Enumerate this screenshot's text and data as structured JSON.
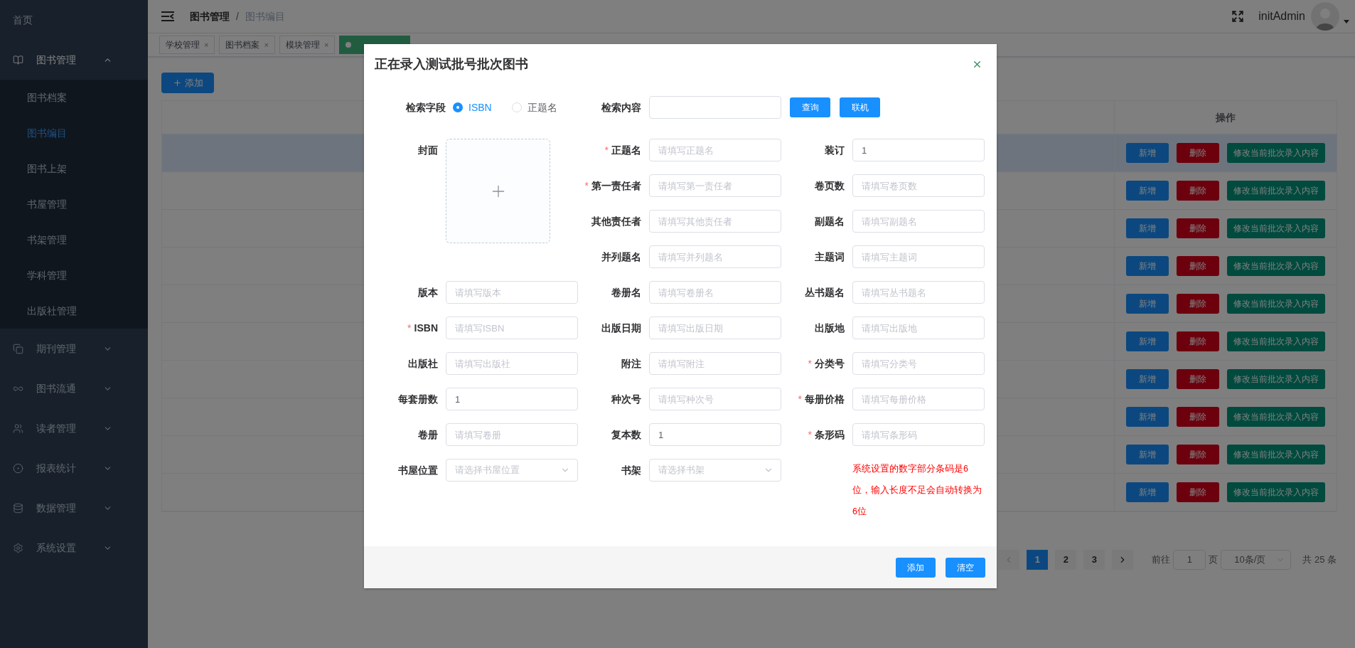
{
  "sidebar": {
    "items": [
      {
        "label": "首页",
        "expanded": false
      },
      {
        "label": "图书管理",
        "expanded": true,
        "children": [
          {
            "label": "图书档案",
            "selected": false
          },
          {
            "label": "图书编目",
            "selected": true
          },
          {
            "label": "图书上架",
            "selected": false
          },
          {
            "label": "书屋管理",
            "selected": false
          },
          {
            "label": "书架管理",
            "selected": false
          },
          {
            "label": "学科管理",
            "selected": false
          },
          {
            "label": "出版社管理",
            "selected": false
          }
        ]
      },
      {
        "label": "期刊管理",
        "expanded": false
      },
      {
        "label": "图书流通",
        "expanded": false
      },
      {
        "label": "读者管理",
        "expanded": false
      },
      {
        "label": "报表统计",
        "expanded": false
      },
      {
        "label": "数据管理",
        "expanded": false
      },
      {
        "label": "系统设置",
        "expanded": false
      }
    ]
  },
  "header": {
    "breadcrumb": [
      "图书管理",
      "图书编目"
    ],
    "separator": "/",
    "user": "initAdmin"
  },
  "tags": [
    {
      "label": "学校管理",
      "selected": false
    },
    {
      "label": "图书档案",
      "selected": false
    },
    {
      "label": "模块管理",
      "selected": false
    },
    {
      "selected": true
    }
  ],
  "tag_close": "×",
  "add_button": "添加",
  "table": {
    "columns": [
      "操作"
    ],
    "rows": [
      {
        "selected": true,
        "actions": [
          {
            "kind": "add",
            "label": "新增"
          },
          {
            "kind": "delete",
            "label": "删除"
          },
          {
            "kind": "edit",
            "label": "修改当前批次录入内容"
          }
        ]
      },
      {
        "selected": false,
        "actions": [
          {
            "kind": "add",
            "label": "新增"
          },
          {
            "kind": "delete",
            "label": "删除"
          },
          {
            "kind": "edit",
            "label": "修改当前批次录入内容"
          }
        ]
      },
      {
        "selected": false,
        "actions": [
          {
            "kind": "add",
            "label": "新增"
          },
          {
            "kind": "delete",
            "label": "删除"
          },
          {
            "kind": "edit",
            "label": "修改当前批次录入内容"
          }
        ]
      },
      {
        "selected": false,
        "actions": [
          {
            "kind": "add",
            "label": "新增"
          },
          {
            "kind": "delete",
            "label": "删除"
          },
          {
            "kind": "edit",
            "label": "修改当前批次录入内容"
          }
        ]
      },
      {
        "selected": false,
        "actions": [
          {
            "kind": "add",
            "label": "新增"
          },
          {
            "kind": "delete",
            "label": "删除"
          },
          {
            "kind": "edit",
            "label": "修改当前批次录入内容"
          }
        ]
      },
      {
        "selected": false,
        "actions": [
          {
            "kind": "add",
            "label": "新增"
          },
          {
            "kind": "delete",
            "label": "删除"
          },
          {
            "kind": "edit",
            "label": "修改当前批次录入内容"
          }
        ]
      },
      {
        "selected": false,
        "actions": [
          {
            "kind": "add",
            "label": "新增"
          },
          {
            "kind": "delete",
            "label": "删除"
          },
          {
            "kind": "edit",
            "label": "修改当前批次录入内容"
          }
        ]
      },
      {
        "selected": false,
        "actions": [
          {
            "kind": "add",
            "label": "新增"
          },
          {
            "kind": "delete",
            "label": "删除"
          },
          {
            "kind": "edit",
            "label": "修改当前批次录入内容"
          }
        ]
      },
      {
        "selected": false,
        "actions": [
          {
            "kind": "add",
            "label": "新增"
          },
          {
            "kind": "delete",
            "label": "删除"
          },
          {
            "kind": "edit",
            "label": "修改当前批次录入内容"
          }
        ]
      },
      {
        "selected": false,
        "actions": [
          {
            "kind": "add",
            "label": "新增"
          },
          {
            "kind": "delete",
            "label": "删除"
          },
          {
            "kind": "edit",
            "label": "修改当前批次录入内容"
          }
        ]
      }
    ]
  },
  "pagination": {
    "prev_disabled": true,
    "pages": [
      {
        "label": "1",
        "selected": true
      },
      {
        "label": "2",
        "selected": false
      },
      {
        "label": "3",
        "selected": false
      }
    ],
    "goto_label": "前往",
    "goto_value": "1",
    "goto_unit": "页",
    "page_size": "10条/页",
    "total": "共 25 条"
  },
  "dialog": {
    "title": "正在录入测试批号批次图书",
    "search": {
      "field_label": "检索字段",
      "options": [
        {
          "label": "ISBN",
          "selected": true
        },
        {
          "label": "正题名",
          "selected": false
        }
      ],
      "content_label": "检索内容",
      "buttons": [
        "查询",
        "联机"
      ]
    },
    "required_mark": "*",
    "form": [
      {
        "kind": "upload",
        "label": "封面",
        "required": false
      },
      {
        "kind": "input",
        "label": "正题名",
        "required": true,
        "placeholder": "请填写正题名"
      },
      {
        "kind": "input",
        "label": "装订",
        "required": false,
        "value": "1"
      },
      {
        "kind": "input",
        "label": "第一责任者",
        "required": true,
        "placeholder": "请填写第一责任者"
      },
      {
        "kind": "input",
        "label": "卷页数",
        "required": false,
        "placeholder": "请填写卷页数"
      },
      {
        "kind": "input",
        "label": "其他责任者",
        "required": false,
        "placeholder": "请填写其他责任者"
      },
      {
        "kind": "input",
        "label": "副题名",
        "required": false,
        "placeholder": "请填写副题名"
      },
      {
        "kind": "input",
        "label": "并列题名",
        "required": false,
        "placeholder": "请填写并列题名"
      },
      {
        "kind": "input",
        "label": "主题词",
        "required": false,
        "placeholder": "请填写主题词"
      },
      {
        "kind": "input",
        "label": "版本",
        "required": false,
        "placeholder": "请填写版本"
      },
      {
        "kind": "input",
        "label": "卷册名",
        "required": false,
        "placeholder": "请填写卷册名"
      },
      {
        "kind": "input",
        "label": "丛书题名",
        "required": false,
        "placeholder": "请填写丛书题名"
      },
      {
        "kind": "input",
        "label": "ISBN",
        "required": true,
        "placeholder": "请填写ISBN"
      },
      {
        "kind": "input",
        "label": "出版日期",
        "required": false,
        "placeholder": "请填写出版日期"
      },
      {
        "kind": "input",
        "label": "出版地",
        "required": false,
        "placeholder": "请填写出版地"
      },
      {
        "kind": "input",
        "label": "出版社",
        "required": false,
        "placeholder": "请填写出版社"
      },
      {
        "kind": "input",
        "label": "附注",
        "required": false,
        "placeholder": "请填写附注"
      },
      {
        "kind": "input",
        "label": "分类号",
        "required": true,
        "placeholder": "请填写分类号"
      },
      {
        "kind": "input",
        "label": "每套册数",
        "required": false,
        "value": "1"
      },
      {
        "kind": "input",
        "label": "种次号",
        "required": false,
        "placeholder": "请填写种次号"
      },
      {
        "kind": "input",
        "label": "每册价格",
        "required": true,
        "placeholder": "请填写每册价格"
      },
      {
        "kind": "input",
        "label": "卷册",
        "required": false,
        "placeholder": "请填写卷册"
      },
      {
        "kind": "input",
        "label": "复本数",
        "required": false,
        "value": "1"
      },
      {
        "kind": "input",
        "label": "条形码",
        "required": true,
        "placeholder": "请填写条形码"
      },
      {
        "kind": "select",
        "label": "书屋位置",
        "required": false,
        "placeholder": "请选择书屋位置"
      },
      {
        "kind": "select",
        "label": "书架",
        "required": false,
        "placeholder": "请选择书架"
      },
      {
        "kind": "note",
        "text": "系统设置的数字部分条码是6位，输入长度不足会自动转换为6位"
      }
    ],
    "footer_buttons": [
      "添加",
      "清空"
    ]
  }
}
